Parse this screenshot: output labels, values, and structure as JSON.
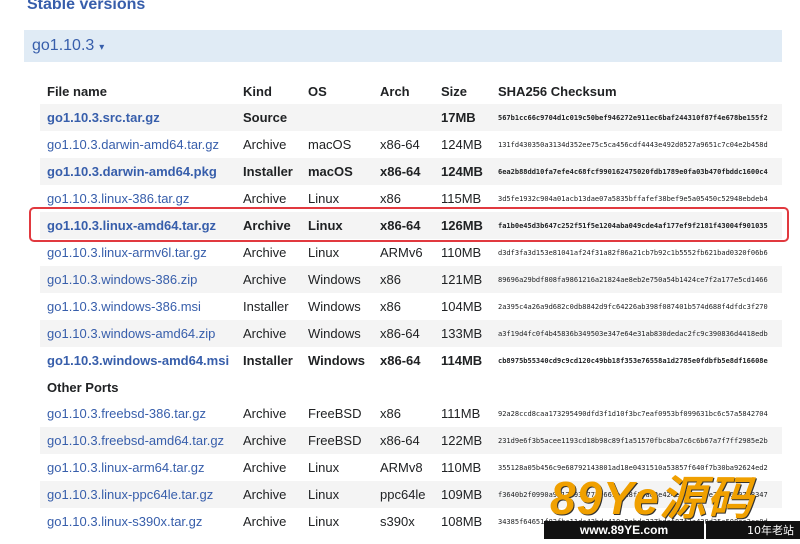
{
  "section_title": "Stable versions",
  "release_toggle": {
    "label": "go1.10.3",
    "caret": "▾"
  },
  "columns": [
    "File name",
    "Kind",
    "OS",
    "Arch",
    "Size",
    "SHA256 Checksum"
  ],
  "files": [
    {
      "name": "go1.10.3.src.tar.gz",
      "kind": "Source",
      "os": "",
      "arch": "",
      "size": "17MB",
      "sha": "567b1cc66c9704d1c019c50bef946272e911ec6baf244310f87f4e678be155f2",
      "primary": true
    },
    {
      "name": "go1.10.3.darwin-amd64.tar.gz",
      "kind": "Archive",
      "os": "macOS",
      "arch": "x86-64",
      "size": "124MB",
      "sha": "131fd430350a3134d352ee75c5ca456cdf4443e492d0527a9651c7c04e2b458d",
      "primary": false
    },
    {
      "name": "go1.10.3.darwin-amd64.pkg",
      "kind": "Installer",
      "os": "macOS",
      "arch": "x86-64",
      "size": "124MB",
      "sha": "6ea2b88dd10fa7efe4c68fcf990162475020fdb1789e0fa03b470fbddc1600c4",
      "primary": true
    },
    {
      "name": "go1.10.3.linux-386.tar.gz",
      "kind": "Archive",
      "os": "Linux",
      "arch": "x86",
      "size": "115MB",
      "sha": "3d5fe1932c904a01acb13dae07a5835bffafef38bef9e5a05450c52948ebdeb4",
      "primary": false
    },
    {
      "name": "go1.10.3.linux-amd64.tar.gz",
      "kind": "Archive",
      "os": "Linux",
      "arch": "x86-64",
      "size": "126MB",
      "sha": "fa1b0e45d3b647c252f51f5e1204aba049cde4af177ef9f2181f43004f901035",
      "primary": true
    },
    {
      "name": "go1.10.3.linux-armv6l.tar.gz",
      "kind": "Archive",
      "os": "Linux",
      "arch": "ARMv6",
      "size": "110MB",
      "sha": "d3df3fa3d153e81041af24f31a82f86a21cb7b92c1b5552fb621bad0320f06b6",
      "primary": false
    },
    {
      "name": "go1.10.3.windows-386.zip",
      "kind": "Archive",
      "os": "Windows",
      "arch": "x86",
      "size": "121MB",
      "sha": "89696a29bdf808fa9861216a21824ae8eb2e750a54b1424ce7f2a177e5cd1466",
      "primary": false
    },
    {
      "name": "go1.10.3.windows-386.msi",
      "kind": "Installer",
      "os": "Windows",
      "arch": "x86",
      "size": "104MB",
      "sha": "2a395c4a26a9d682c0db8842d9fc64226ab398f087401b574d688f4dfdc3f270",
      "primary": false
    },
    {
      "name": "go1.10.3.windows-amd64.zip",
      "kind": "Archive",
      "os": "Windows",
      "arch": "x86-64",
      "size": "133MB",
      "sha": "a3f19d4fc0f4b45836b349503e347e64e31ab830dedac2fc9c390836d4418edb",
      "primary": false
    },
    {
      "name": "go1.10.3.windows-amd64.msi",
      "kind": "Installer",
      "os": "Windows",
      "arch": "x86-64",
      "size": "114MB",
      "sha": "cb8975b55340cd9c9cd120c49bb18f353e76558a1d2785e0fdbfb5e8df16608e",
      "primary": true
    }
  ],
  "other_ports_label": "Other Ports",
  "other_files": [
    {
      "name": "go1.10.3.freebsd-386.tar.gz",
      "kind": "Archive",
      "os": "FreeBSD",
      "arch": "x86",
      "size": "111MB",
      "sha": "92a28ccd8caa173295490dfd3f1d10f3bc7eaf0953bf099631bc6c57a5842704"
    },
    {
      "name": "go1.10.3.freebsd-amd64.tar.gz",
      "kind": "Archive",
      "os": "FreeBSD",
      "arch": "x86-64",
      "size": "122MB",
      "sha": "231d9e6f3b5acee1193cd18b98c89f1a51570fbc8ba7c6c6b67a7f7ff2985e2b"
    },
    {
      "name": "go1.10.3.linux-arm64.tar.gz",
      "kind": "Archive",
      "os": "Linux",
      "arch": "ARMv8",
      "size": "110MB",
      "sha": "355128a05b456c9e68792143801ad18e0431510a53857f640f7b30ba92624ed2"
    },
    {
      "name": "go1.10.3.linux-ppc64le.tar.gz",
      "kind": "Archive",
      "os": "Linux",
      "arch": "ppc64le",
      "size": "109MB",
      "sha": "f3640b2f0990a9617c937775f669ee18f10a82e424e5f87a8ce794a6407b8347"
    },
    {
      "name": "go1.10.3.linux-s390x.tar.gz",
      "kind": "Archive",
      "os": "Linux",
      "arch": "s390x",
      "size": "108MB",
      "sha": "34385f64651f82fbc11dc43bdc410c2abda237bdef87f3a430d35a508ec3ce0d"
    }
  ],
  "watermark": {
    "brand": "89Ye源码",
    "url": "www.89YE.com",
    "tag": "10年老站"
  },
  "colors": {
    "link": "#375eab",
    "header_bar": "#e0ebf5",
    "highlight_border": "#e1393f",
    "row_alt": "#f4f4f4"
  }
}
